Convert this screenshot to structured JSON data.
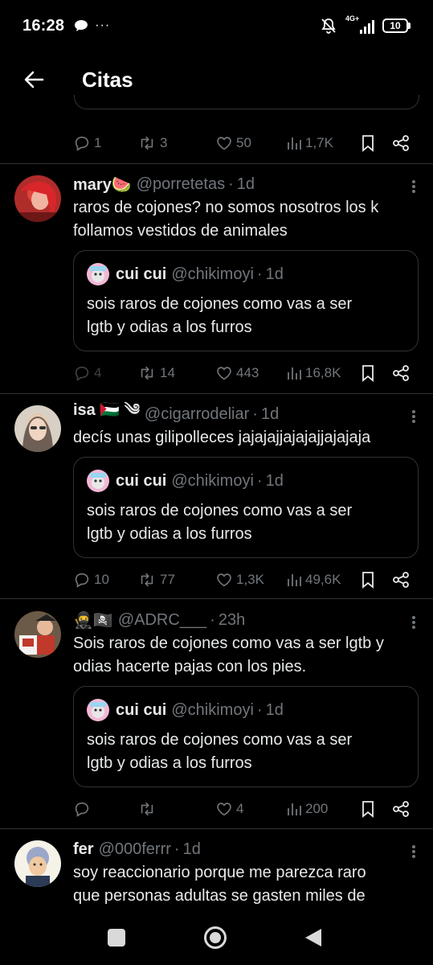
{
  "status_bar": {
    "time": "16:28",
    "battery": "10",
    "network": "4G+"
  },
  "header": {
    "title": "Citas"
  },
  "prev_actions": {
    "replies": "1",
    "retweets": "3",
    "likes": "50",
    "views": "1,7K"
  },
  "quoted": {
    "name": "cui cui",
    "handle": "@chikimoyi",
    "time": "1d",
    "text_line1": "sois raros de cojones como vas a ser",
    "text_line2": "lgtb y odias a los furros"
  },
  "tweets": [
    {
      "name": "mary🍉",
      "handle": "@porretetas",
      "time": "1d",
      "line1": "raros de cojones? no somos nosotros los k",
      "line2": "follamos vestidos de animales",
      "replies": "4",
      "retweets": "14",
      "likes": "443",
      "views": "16,8K"
    },
    {
      "name": "isa 🇵🇸 ༄",
      "handle": "@cigarrodeliar",
      "time": "1d",
      "line1": "decís unas gilipolleces jajajajjajajajjajajaja",
      "line2": "",
      "replies": "10",
      "retweets": "77",
      "likes": "1,3K",
      "views": "49,6K"
    },
    {
      "name": "🥷🏴‍☠️",
      "handle": "@ADRC___",
      "time": "23h",
      "line1": "Sois raros de cojones como vas a ser lgtb y",
      "line2": "odias hacerte pajas con los pies.",
      "replies": "",
      "retweets": "",
      "likes": "4",
      "views": "200"
    },
    {
      "name": "fer",
      "handle": "@000ferrr",
      "time": "1d",
      "line1": "soy reaccionario porque me parezca raro",
      "line2": "que personas adultas se gasten miles de"
    }
  ],
  "colors": {
    "background": "#000000",
    "text": "#e7e9ea",
    "muted": "#71767b",
    "border": "#2f3336"
  }
}
